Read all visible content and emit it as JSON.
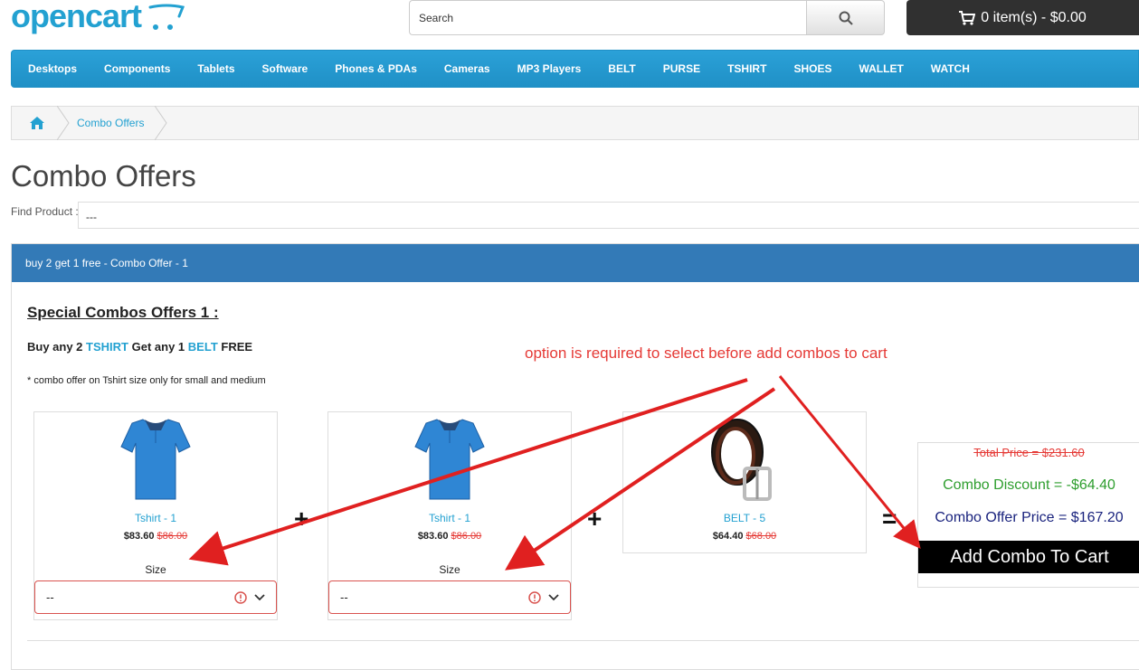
{
  "header": {
    "logo_text": "opencart",
    "search_placeholder": "Search",
    "cart_label": "0 item(s) - $0.00"
  },
  "menu": [
    "Desktops",
    "Components",
    "Tablets",
    "Software",
    "Phones & PDAs",
    "Cameras",
    "MP3 Players",
    "BELT",
    "PURSE",
    "TSHIRT",
    "SHOES",
    "WALLET",
    "WATCH"
  ],
  "breadcrumb": {
    "current": "Combo Offers"
  },
  "page": {
    "title": "Combo Offers",
    "find_label": "Find Product :",
    "find_value": "---"
  },
  "panel": {
    "heading": "buy 2 get 1 free - Combo Offer - 1",
    "combo_title": "Special Combos Offers 1 :",
    "sub_buy": "Buy any 2",
    "sub_item1": "TSHIRT",
    "sub_get": "Get any 1",
    "sub_item2": "BELT",
    "sub_free": "FREE",
    "note": "* combo offer on Tshirt size only for small and medium"
  },
  "products": [
    {
      "name": "Tshirt - 1",
      "price": "$83.60",
      "old_price": "$86.00",
      "size_label": "Size",
      "size_value": "--"
    },
    {
      "name": "Tshirt - 1",
      "price": "$83.60",
      "old_price": "$86.00",
      "size_label": "Size",
      "size_value": "--"
    },
    {
      "name": "BELT - 5",
      "price": "$64.40",
      "old_price": "$68.00"
    }
  ],
  "operators": {
    "plus": "+",
    "equals": "="
  },
  "summary": {
    "total": "Total Price = $231.60",
    "discount": "Combo Discount = -$64.40",
    "offer": "Combo Offer Price = $167.20",
    "button": "Add Combo To Cart"
  },
  "annotation": "option is required to select before add combos to cart",
  "colors": {
    "brand": "#23a1d1",
    "menu": "#229ac8",
    "panel_head": "#337ab7",
    "error": "#d9534f",
    "annotation": "#e53935"
  }
}
